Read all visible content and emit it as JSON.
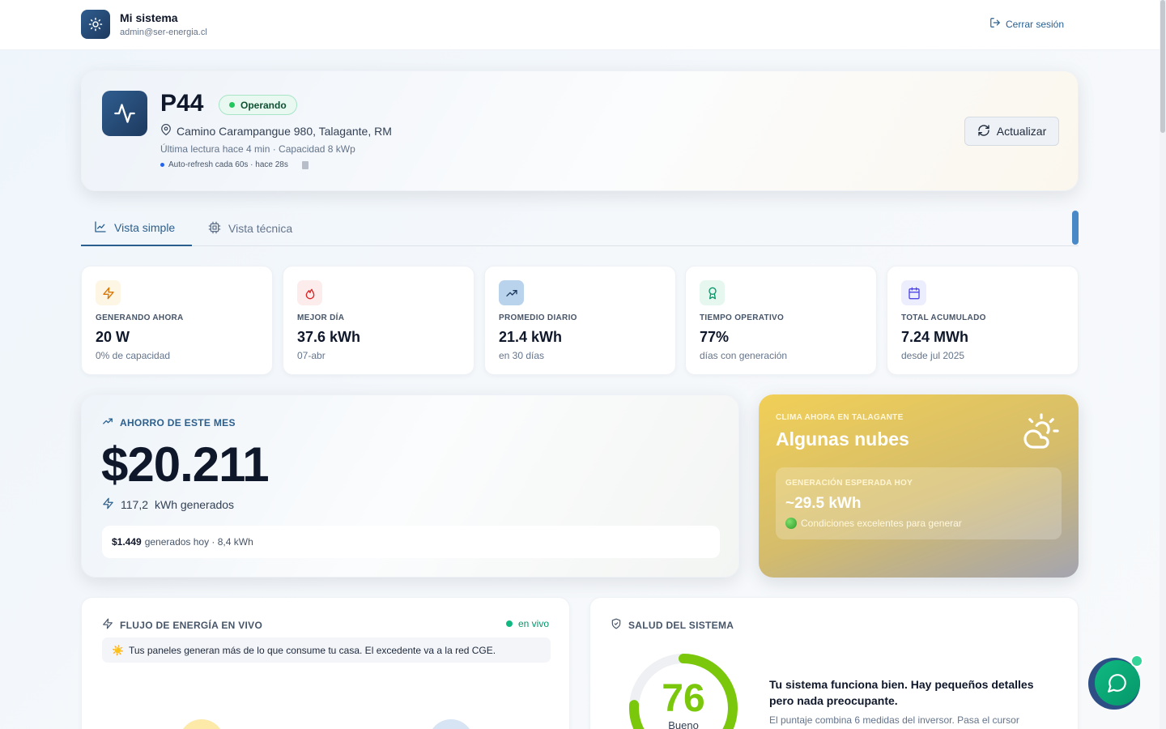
{
  "header": {
    "brand_title": "Mi sistema",
    "user_email": "admin@ser-energia.cl",
    "logout_label": "Cerrar sesión",
    "logo_icon": "sun-icon",
    "logout_icon": "logout-icon"
  },
  "plant": {
    "name": "P44",
    "status": "Operando",
    "address": "Camino Carampangue 980, Talagante, RM",
    "meta": "Última lectura hace 4 min · Capacidad 8 kWp",
    "refresh_info": "Auto-refresh cada 60s · hace 28s",
    "refresh_button": "Actualizar",
    "icon": "activity-pulse-icon"
  },
  "tabs": [
    {
      "label": "Vista simple",
      "icon": "line-chart-icon",
      "active": true
    },
    {
      "label": "Vista técnica",
      "icon": "cpu-icon",
      "active": false
    }
  ],
  "stats": [
    {
      "label": "GENERANDO AHORA",
      "value": "20 W",
      "sub": "0% de capacidad",
      "icon": "zap-icon",
      "accent": "#d97706",
      "bg": "#fef6e4"
    },
    {
      "label": "MEJOR DÍA",
      "value": "37.6 kWh",
      "sub": "07-abr",
      "icon": "flame-icon",
      "accent": "#dc2626",
      "bg": "#fdecec"
    },
    {
      "label": "PROMEDIO DIARIO",
      "value": "21.4 kWh",
      "sub": "en 30 días",
      "icon": "trending-up-icon",
      "accent": "#1e3a5f",
      "bg": "#b9d3ec"
    },
    {
      "label": "TIEMPO OPERATIVO",
      "value": "77%",
      "sub": "días con generación",
      "icon": "award-icon",
      "accent": "#059669",
      "bg": "#e6f7ef"
    },
    {
      "label": "TOTAL ACUMULADO",
      "value": "7.24 MWh",
      "sub": "desde jul 2025",
      "icon": "calendar-icon",
      "accent": "#4f46e5",
      "bg": "#eceefe"
    }
  ],
  "savings": {
    "label": "AHORRO DE ESTE MES",
    "amount": "$20.211",
    "kwh_value": "117,2",
    "kwh_label": "kWh generados",
    "today_amount": "$1.449",
    "today_text": "generados hoy · 8,4 kWh"
  },
  "weather": {
    "label": "CLIMA AHORA EN TALAGANTE",
    "condition": "Algunas nubes",
    "expected_label": "GENERACIÓN ESPERADA HOY",
    "expected_value": "~29.5 kWh",
    "note": "Condiciones excelentes para generar",
    "icon": "cloud-sun-icon"
  },
  "flow": {
    "label": "FLUJO DE ENERGÍA EN VIVO",
    "live_label": "en vivo",
    "message": "Tus paneles generan más de lo que consume tu casa. El excedente va a la red CGE.",
    "message_emoji": "☀️"
  },
  "health": {
    "label": "SALUD DEL SISTEMA",
    "score": "76",
    "score_fraction": 0.76,
    "score_word": "Bueno",
    "title": "Tu sistema funciona bien. Hay pequeños detalles pero nada preocupante.",
    "description": "El puntaje combina 6 medidas del inversor. Pasa el cursor",
    "accent": "#7ac70c"
  },
  "chat": {
    "icon": "chat-bubble-icon"
  }
}
